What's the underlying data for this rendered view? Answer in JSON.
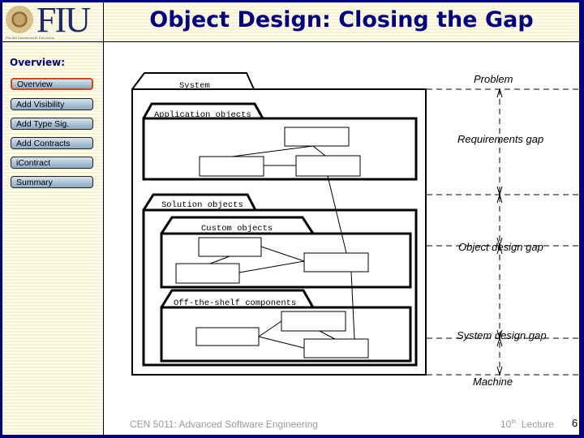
{
  "header": {
    "logo_text": "FIU",
    "logo_subtitle": "Florida International University",
    "title": "Object Design: Closing the Gap"
  },
  "sidebar": {
    "title": "Overview:",
    "items": [
      {
        "label": "Overview",
        "active": true
      },
      {
        "label": "Add Visibility",
        "active": false
      },
      {
        "label": "Add Type Sig.",
        "active": false
      },
      {
        "label": "Add Contracts",
        "active": false
      },
      {
        "label": "iContract",
        "active": false
      },
      {
        "label": "Summary",
        "active": false
      }
    ]
  },
  "diagram": {
    "packages": {
      "system": "System",
      "application_objects": "Application objects",
      "solution_objects": "Solution objects",
      "custom_objects": "Custom objects",
      "off_the_shelf": "Off-the-shelf components"
    },
    "levels": {
      "problem": "Problem",
      "machine": "Machine"
    },
    "gaps": [
      "Requirements gap",
      "Object design gap",
      "System design gap"
    ]
  },
  "footer": {
    "course": "CEN 5011: Advanced Software Engineering",
    "lecture_number": "10",
    "lecture_suffix": "th",
    "lecture_word": "Lecture",
    "page": "6"
  }
}
